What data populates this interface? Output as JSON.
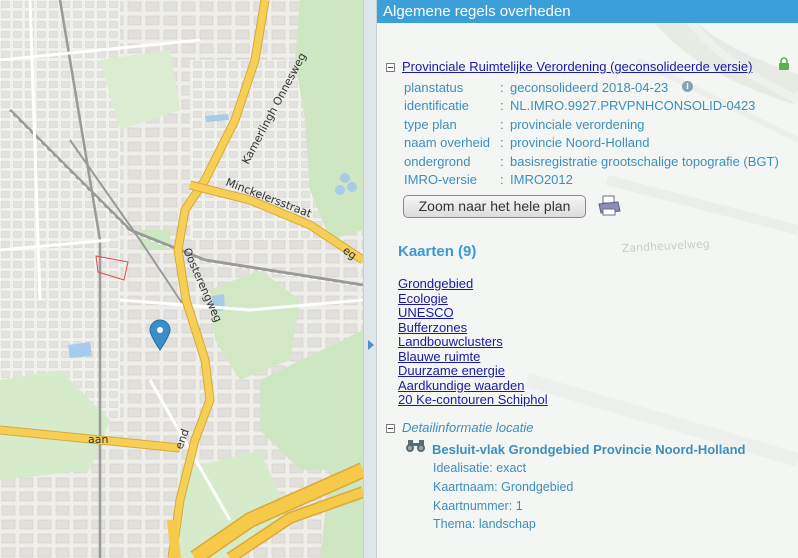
{
  "map": {
    "streets": {
      "kamerlingh_onnesweg": "Kamerlingh Onnesweg",
      "minckelersstraat": "Minckelersstraat",
      "oosterengweg": "Oosterengweg",
      "eg_fragment": "eg",
      "end_fragment": "end",
      "aan_fragment": "aan"
    },
    "colors": {
      "road_major": "#f6cf57",
      "road_outline": "#d9a93a",
      "green": "#cfe6c2",
      "water": "#a7cbe8",
      "rail": "#9a9a9a",
      "marker": "#3a8fc9"
    }
  },
  "panel": {
    "header": "Algemene regels overheden",
    "plan_title": "Provinciale Ruimtelijke Verordening (geconsolideerde versie)",
    "properties": [
      {
        "key": "planstatus",
        "value": "geconsolideerd 2018-04-23"
      },
      {
        "key": "identificatie",
        "value": "NL.IMRO.9927.PRVPNHCONSOLID-0423"
      },
      {
        "key": "type plan",
        "value": "provinciale verordening"
      },
      {
        "key": "naam overheid",
        "value": "provincie Noord-Holland"
      },
      {
        "key": "ondergrond",
        "value": "basisregistratie grootschalige topografie (BGT)"
      },
      {
        "key": "IMRO-versie",
        "value": "IMRO2012"
      }
    ],
    "separator": ":",
    "info_icon": "i",
    "zoom_button": "Zoom naar het hele plan",
    "kaarten_heading": "Kaarten (9)",
    "kaarten": [
      "Grondgebied",
      "Ecologie",
      "UNESCO",
      "Bufferzones",
      "Landbouwclusters",
      "Blauwe ruimte",
      "Duurzame energie",
      "Aardkundige waarden",
      "20 Ke-contouren Schiphol"
    ],
    "detail_heading": "Detailinformatie locatie",
    "besluit_title": "Besluit-vlak Grondgebied Provincie Noord-Holland",
    "details": [
      {
        "key": "Idealisatie",
        "value": "exact"
      },
      {
        "key": "Kaartnaam",
        "value": "Grondgebied"
      },
      {
        "key": "Kaartnummer",
        "value": "1"
      },
      {
        "key": "Thema",
        "value": "landschap"
      }
    ],
    "background_labels": {
      "zandheuvelweg": "Zandheuvelweg"
    },
    "icons": {
      "lock": "lock-icon",
      "print": "printer-icon",
      "binoculars": "binoculars-icon",
      "toggle": "collapse-icon"
    }
  }
}
